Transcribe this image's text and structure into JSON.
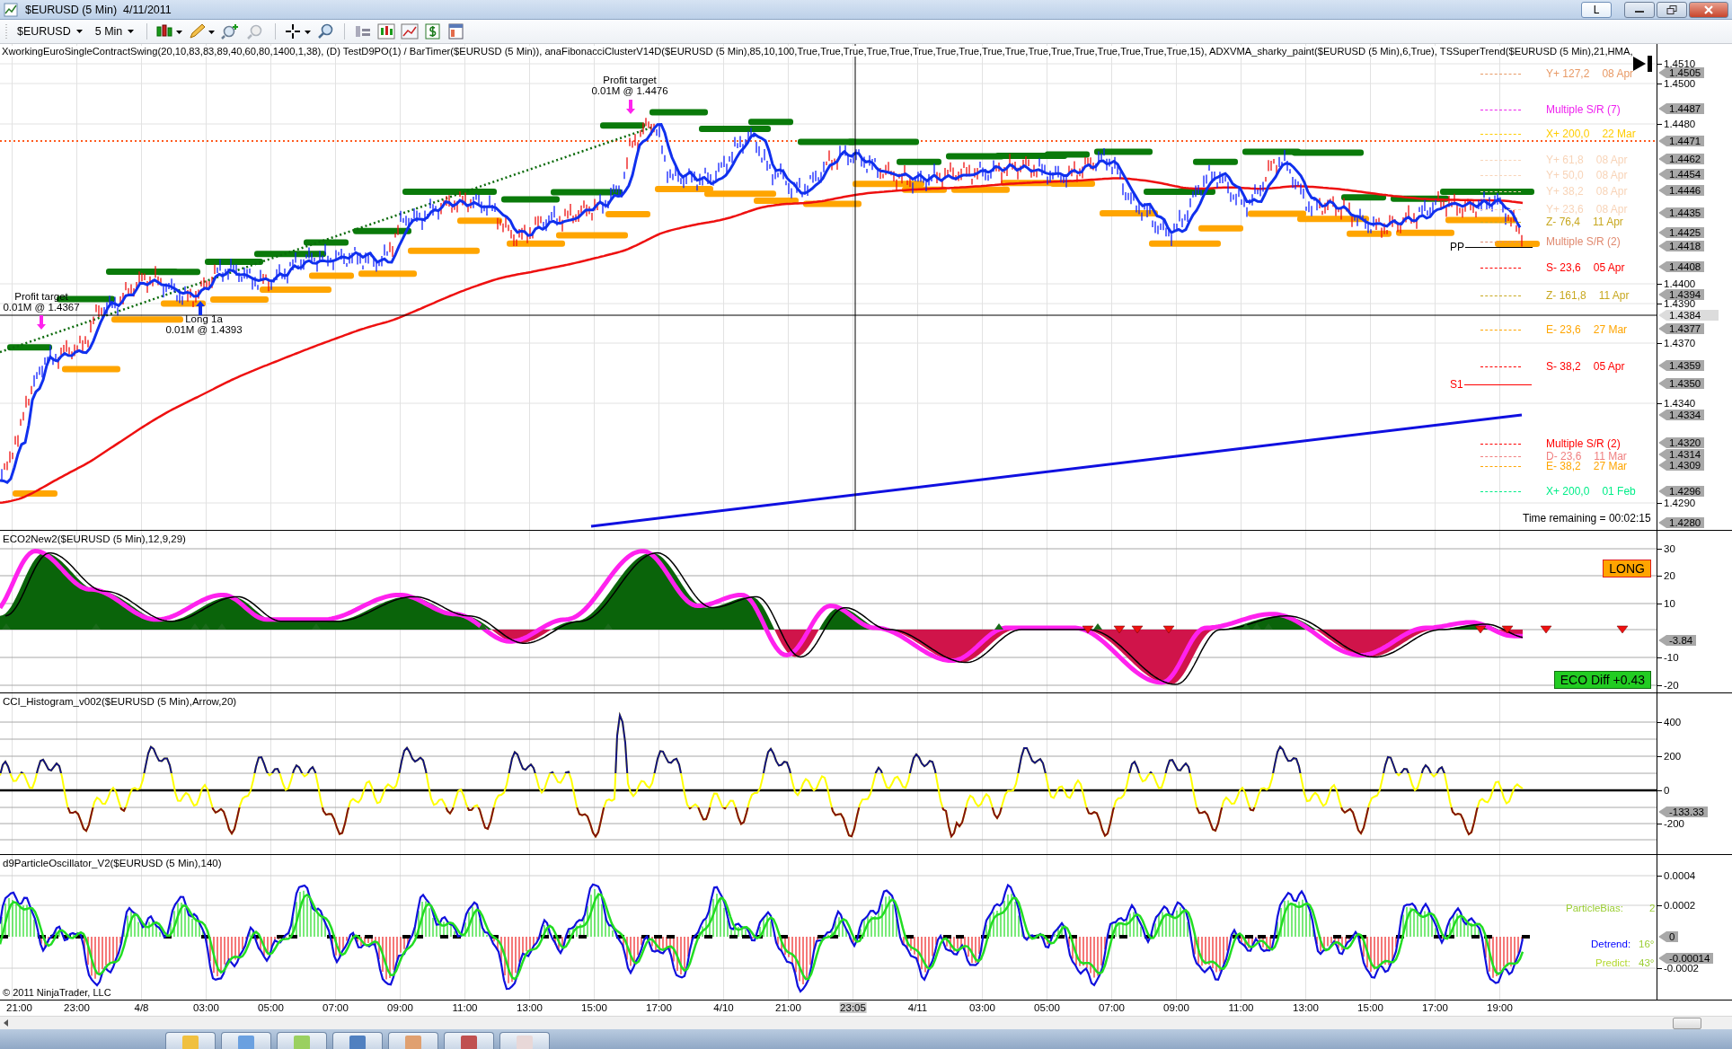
{
  "window": {
    "title": "$EURUSD (5 Min)  4/11/2011",
    "link_button": "L"
  },
  "toolbar": {
    "instrument": "$EURUSD",
    "interval": "5 Min"
  },
  "price_panel": {
    "legend": "XworkingEuroSingleContractSwing(20,10,83,83,89,40,60,80,1400,1,38), (D) TestD9PO(1) / BarTimer($EURUSD (5 Min)), anaFibonacciClusterV14D($EURUSD (5 Min),85,10,100,True,True,True,True,True,True,True,True,True,True,True,True,True,True,True,True,True,15), ADXVMA_sharky_paint($EURUSD (5 Min),6,True), TSSuperTrend($EURUSD (5 Min),21,HMA,",
    "price_ticks": [
      "1.4510",
      "1.4500",
      "1.4480",
      "1.4400",
      "1.4390",
      "1.4370",
      "1.4340",
      "1.4290"
    ],
    "price_tags": [
      {
        "value": "1.4505",
        "current": false
      },
      {
        "value": "1.4487",
        "current": false
      },
      {
        "value": "1.4471",
        "current": false
      },
      {
        "value": "1.4462",
        "current": false
      },
      {
        "value": "1.4454",
        "current": false
      },
      {
        "value": "1.4446",
        "current": false
      },
      {
        "value": "1.4435",
        "current": false
      },
      {
        "value": "1.4425",
        "current": false
      },
      {
        "value": "1.4418",
        "current": false
      },
      {
        "value": "1.4408",
        "current": false
      },
      {
        "value": "1.4394",
        "current": false
      },
      {
        "value": "1.4384",
        "current": true
      },
      {
        "value": "1.4377",
        "current": false
      },
      {
        "value": "1.4359",
        "current": false
      },
      {
        "value": "1.4350",
        "current": false
      },
      {
        "value": "1.4334",
        "current": false
      },
      {
        "value": "1.4320",
        "current": false
      },
      {
        "value": "1.4314",
        "current": false
      },
      {
        "value": "1.4309",
        "current": false
      },
      {
        "value": "1.4296",
        "current": false
      },
      {
        "value": "1.4280",
        "current": false
      }
    ],
    "levels": [
      {
        "label": "Y+ 127,2",
        "date": "08 Apr",
        "color": "#e89a66"
      },
      {
        "label": "Multiple S/R (7)",
        "color": "#ee22ee"
      },
      {
        "label": "X+ 200,0",
        "date": "22 Mar",
        "color": "#ffcc00"
      },
      {
        "label": "Y+ 61,8",
        "date": "08 Apr",
        "color": "#f8d4b8"
      },
      {
        "label": "Y+ 50,0",
        "date": "08 Apr",
        "color": "#f8d4b8"
      },
      {
        "label": "Y+ 38,2",
        "date": "08 Apr",
        "color": "#f8d4b8"
      },
      {
        "label": "Y+ 23,6",
        "date": "08 Apr",
        "color": "#f8d4b8"
      },
      {
        "label": "Z- 76,4",
        "date": "11 Apr",
        "color": "#c8a820"
      },
      {
        "label": "Multiple S/R (2)",
        "color": "#e08a70"
      },
      {
        "label": "S- 23,6",
        "date": "05 Apr",
        "color": "#ff0000"
      },
      {
        "label": "Z- 161,8",
        "date": "11 Apr",
        "color": "#c8a820"
      },
      {
        "label": "E- 23,6",
        "date": "27 Mar",
        "color": "#ffa500"
      },
      {
        "label": "S- 38,2",
        "date": "05 Apr",
        "color": "#ff0000"
      },
      {
        "label": "Multiple S/R (2)",
        "color": "#ff0000"
      },
      {
        "label": "D- 23,6",
        "date": "11 Mar",
        "color": "#f08080"
      },
      {
        "label": "E- 38,2",
        "date": "27 Mar",
        "color": "#ffa500"
      },
      {
        "label": "X+ 200,0",
        "date": "01 Feb",
        "color": "#00ee88"
      }
    ],
    "pivots": [
      {
        "label": "PP",
        "color": "#000000"
      },
      {
        "label": "S1",
        "color": "#ff0000"
      }
    ],
    "trades": [
      {
        "kind": "exit",
        "title": "Profit target",
        "detail": "0.01M @ 1.4367"
      },
      {
        "kind": "entry",
        "title": "Long 1a",
        "detail": "0.01M @ 1.4393"
      },
      {
        "kind": "exit",
        "title": "Profit target",
        "detail": "0.01M @ 1.4476"
      }
    ],
    "time_remaining": "Time remaining = 00:02:15"
  },
  "indicator_panels": [
    {
      "kind": "eco",
      "title": "ECO2New2($EURUSD (5 Min),12,9,29)",
      "ticks": [
        "30",
        "20",
        "10",
        "-10",
        "-20"
      ],
      "tags": [
        "-3.84"
      ],
      "signal": "LONG",
      "diff": "ECO Diff +0.43"
    },
    {
      "kind": "cci",
      "title": "CCI_Histogram_v002($EURUSD (5 Min),Arrow,20)",
      "ticks": [
        "400",
        "200",
        "0",
        "-200"
      ],
      "tags": [
        "-133.33"
      ]
    },
    {
      "kind": "particle",
      "title": "d9ParticleOscillator_V2($EURUSD (5 Min),140)",
      "ticks": [
        "0.0004",
        "0.0002",
        "-0.0002"
      ],
      "tags": [
        "0",
        "-0.00014"
      ],
      "stats": [
        {
          "label": "ParticleBias:",
          "value": "2",
          "color": "#9acd32"
        },
        {
          "label": "Detrend:",
          "value": "16°",
          "color": "#0000ff"
        },
        {
          "label": "Predict:",
          "value": "43°",
          "color": "#b4d82e"
        }
      ],
      "copyright": "© 2011 NinjaTrader, LLC"
    }
  ],
  "time_axis": [
    {
      "label": "21:00",
      "highlighted": false
    },
    {
      "label": "23:00",
      "highlighted": false
    },
    {
      "label": "4/8",
      "highlighted": false
    },
    {
      "label": "03:00",
      "highlighted": false
    },
    {
      "label": "05:00",
      "highlighted": false
    },
    {
      "label": "07:00",
      "highlighted": false
    },
    {
      "label": "09:00",
      "highlighted": false
    },
    {
      "label": "11:00",
      "highlighted": false
    },
    {
      "label": "13:00",
      "highlighted": false
    },
    {
      "label": "15:00",
      "highlighted": false
    },
    {
      "label": "17:00",
      "highlighted": false
    },
    {
      "label": "4/10",
      "highlighted": false
    },
    {
      "label": "21:00",
      "highlighted": false
    },
    {
      "label": "23:05",
      "highlighted": true
    },
    {
      "label": "4/11",
      "highlighted": false
    },
    {
      "label": "03:00",
      "highlighted": false
    },
    {
      "label": "05:00",
      "highlighted": false
    },
    {
      "label": "07:00",
      "highlighted": false
    },
    {
      "label": "09:00",
      "highlighted": false
    },
    {
      "label": "11:00",
      "highlighted": false
    },
    {
      "label": "13:00",
      "highlighted": false
    },
    {
      "label": "15:00",
      "highlighted": false
    },
    {
      "label": "17:00",
      "highlighted": false
    },
    {
      "label": "19:00",
      "highlighted": false
    }
  ]
}
